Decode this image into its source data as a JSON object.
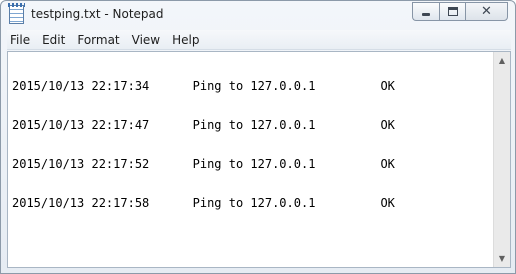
{
  "window": {
    "title": "testping.txt - Notepad",
    "close_glyph": "✕",
    "icons": {
      "app": "notepad-icon",
      "minimize": "minimize-icon",
      "maximize": "maximize-icon",
      "close": "close-icon"
    }
  },
  "menu": {
    "items": [
      {
        "label": "File"
      },
      {
        "label": "Edit"
      },
      {
        "label": "Format"
      },
      {
        "label": "View"
      },
      {
        "label": "Help"
      }
    ]
  },
  "editor": {
    "lines": [
      "2015/10/13 22:17:34      Ping to 127.0.0.1         OK",
      "2015/10/13 22:17:47      Ping to 127.0.0.1         OK",
      "2015/10/13 22:17:52      Ping to 127.0.0.1         OK",
      "2015/10/13 22:17:58      Ping to 127.0.0.1         OK"
    ]
  },
  "scrollbar": {
    "up_glyph": "▲",
    "down_glyph": "▼"
  }
}
